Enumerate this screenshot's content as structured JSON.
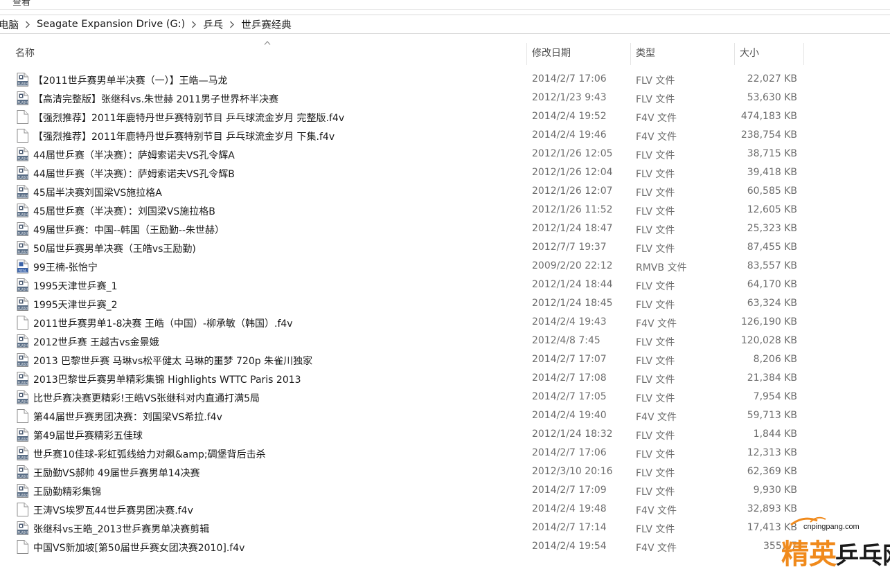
{
  "ribbon": {
    "view_label": "查看"
  },
  "breadcrumb": [
    "电脑",
    "Seagate Expansion Drive (G:)",
    "乒乓",
    "世乒赛经典"
  ],
  "columns": {
    "name": "名称",
    "date": "修改日期",
    "type": "类型",
    "size": "大小"
  },
  "files": [
    {
      "name": "【2011世乒赛男单半决赛（一）】王皓—马龙",
      "date": "2014/2/7 17:06",
      "type": "FLV 文件",
      "size": "22,027 KB",
      "icon": "flash-video-file-icon"
    },
    {
      "name": "【高清完整版】张继科vs.朱世赫 2011男子世界杯半决赛",
      "date": "2012/1/23 9:43",
      "type": "FLV 文件",
      "size": "53,630 KB",
      "icon": "flash-video-file-icon"
    },
    {
      "name": "【强烈推荐】2011年鹿特丹世乒赛特别节目 乒乓球流金岁月 完整版.f4v",
      "date": "2014/2/4 19:52",
      "type": "F4V 文件",
      "size": "474,183 KB",
      "icon": "blank-file-icon"
    },
    {
      "name": "【强烈推荐】2011年鹿特丹世乒赛特别节目 乒乓球流金岁月 下集.f4v",
      "date": "2014/2/4 19:46",
      "type": "F4V 文件",
      "size": "238,754 KB",
      "icon": "blank-file-icon"
    },
    {
      "name": "44届世乒赛（半决赛）：萨姆索诺夫VS孔令辉A",
      "date": "2012/1/26 12:05",
      "type": "FLV 文件",
      "size": "38,715 KB",
      "icon": "flash-video-file-icon"
    },
    {
      "name": "44届世乒赛（半决赛）：萨姆索诺夫VS孔令辉B",
      "date": "2012/1/26 12:04",
      "type": "FLV 文件",
      "size": "39,418 KB",
      "icon": "flash-video-file-icon"
    },
    {
      "name": "45届半决赛刘国梁VS施拉格A",
      "date": "2012/1/26 12:07",
      "type": "FLV 文件",
      "size": "60,585 KB",
      "icon": "flash-video-file-icon"
    },
    {
      "name": "45届世乒赛（半决赛）：刘国梁VS施拉格B",
      "date": "2012/1/26 11:52",
      "type": "FLV 文件",
      "size": "12,605 KB",
      "icon": "flash-video-file-icon"
    },
    {
      "name": "49届世乒赛：中国--韩国（王励勤--朱世赫）",
      "date": "2012/1/24 18:47",
      "type": "FLV 文件",
      "size": "25,323 KB",
      "icon": "flash-video-file-icon"
    },
    {
      "name": "50届世乒赛男单决赛（王皓vs王励勤)",
      "date": "2012/7/7 19:37",
      "type": "FLV 文件",
      "size": "87,455 KB",
      "icon": "flash-video-file-icon"
    },
    {
      "name": "99王楠-张怡宁",
      "date": "2009/2/20 22:12",
      "type": "RMVB 文件",
      "size": "83,557 KB",
      "icon": "realmedia-file-icon"
    },
    {
      "name": "1995天津世乒赛_1",
      "date": "2012/1/24 18:44",
      "type": "FLV 文件",
      "size": "64,170 KB",
      "icon": "flash-video-file-icon"
    },
    {
      "name": "1995天津世乒赛_2",
      "date": "2012/1/24 18:45",
      "type": "FLV 文件",
      "size": "63,324 KB",
      "icon": "flash-video-file-icon"
    },
    {
      "name": "2011世乒赛男单1-8决赛 王皓（中国）-柳承敏（韩国）.f4v",
      "date": "2014/2/4 19:43",
      "type": "F4V 文件",
      "size": "126,190 KB",
      "icon": "blank-file-icon"
    },
    {
      "name": "2012世乒赛 王越古vs金景娥",
      "date": "2012/4/8 7:45",
      "type": "FLV 文件",
      "size": "120,028 KB",
      "icon": "flash-video-file-icon"
    },
    {
      "name": "2013 巴黎世乒赛 马琳vs松平健太 马琳的噩梦 720p 朱雀川独家",
      "date": "2014/2/7 17:07",
      "type": "FLV 文件",
      "size": "8,206 KB",
      "icon": "flash-video-file-icon"
    },
    {
      "name": "2013巴黎世乒赛男单精彩集锦 Highlights WTTC Paris 2013",
      "date": "2014/2/7 17:08",
      "type": "FLV 文件",
      "size": "21,384 KB",
      "icon": "flash-video-file-icon"
    },
    {
      "name": "比世乒赛决赛更精彩!王皓VS张继科对内直通打满5局",
      "date": "2014/2/7 17:05",
      "type": "FLV 文件",
      "size": "7,954 KB",
      "icon": "flash-video-file-icon"
    },
    {
      "name": "第44届世乒赛男团决赛：刘国梁VS希拉.f4v",
      "date": "2014/2/4 19:40",
      "type": "F4V 文件",
      "size": "59,713 KB",
      "icon": "blank-file-icon"
    },
    {
      "name": "第49届世乒赛精彩五佳球",
      "date": "2012/1/24 18:32",
      "type": "FLV 文件",
      "size": "1,844 KB",
      "icon": "flash-video-file-icon"
    },
    {
      "name": "世乒赛10佳球-彩虹弧线给力对飙&amp;碉堡背后击杀",
      "date": "2014/2/7 17:06",
      "type": "FLV 文件",
      "size": "12,313 KB",
      "icon": "flash-video-file-icon"
    },
    {
      "name": "王励勤VS郝帅 49届世乒赛男单14决赛",
      "date": "2012/3/10 20:16",
      "type": "FLV 文件",
      "size": "62,369 KB",
      "icon": "flash-video-file-icon"
    },
    {
      "name": "王励勤精彩集锦",
      "date": "2014/2/7 17:09",
      "type": "FLV 文件",
      "size": "9,930 KB",
      "icon": "flash-video-file-icon"
    },
    {
      "name": "王涛VS埃罗瓦44世乒赛男团决赛.f4v",
      "date": "2014/2/4 19:48",
      "type": "F4V 文件",
      "size": "32,893 KB",
      "icon": "blank-file-icon"
    },
    {
      "name": "张继科vs王皓_2013世乒赛男单决赛剪辑",
      "date": "2014/2/7 17:14",
      "type": "FLV 文件",
      "size": "17,413 KB",
      "icon": "flash-video-file-icon"
    },
    {
      "name": "中国VS新加坡[第50届世乒赛女团决赛2010].f4v",
      "date": "2014/2/4 19:54",
      "type": "F4V 文件",
      "size": "355,17",
      "icon": "blank-file-icon"
    }
  ],
  "watermark": {
    "url": "cnpingpang.com",
    "word1": "精英",
    "word2": "乒乓网"
  },
  "colors": {
    "watermark_orange": "#f08a1c",
    "watermark_dark": "#1a1a1a",
    "flash_badge": "#5a6e86"
  }
}
